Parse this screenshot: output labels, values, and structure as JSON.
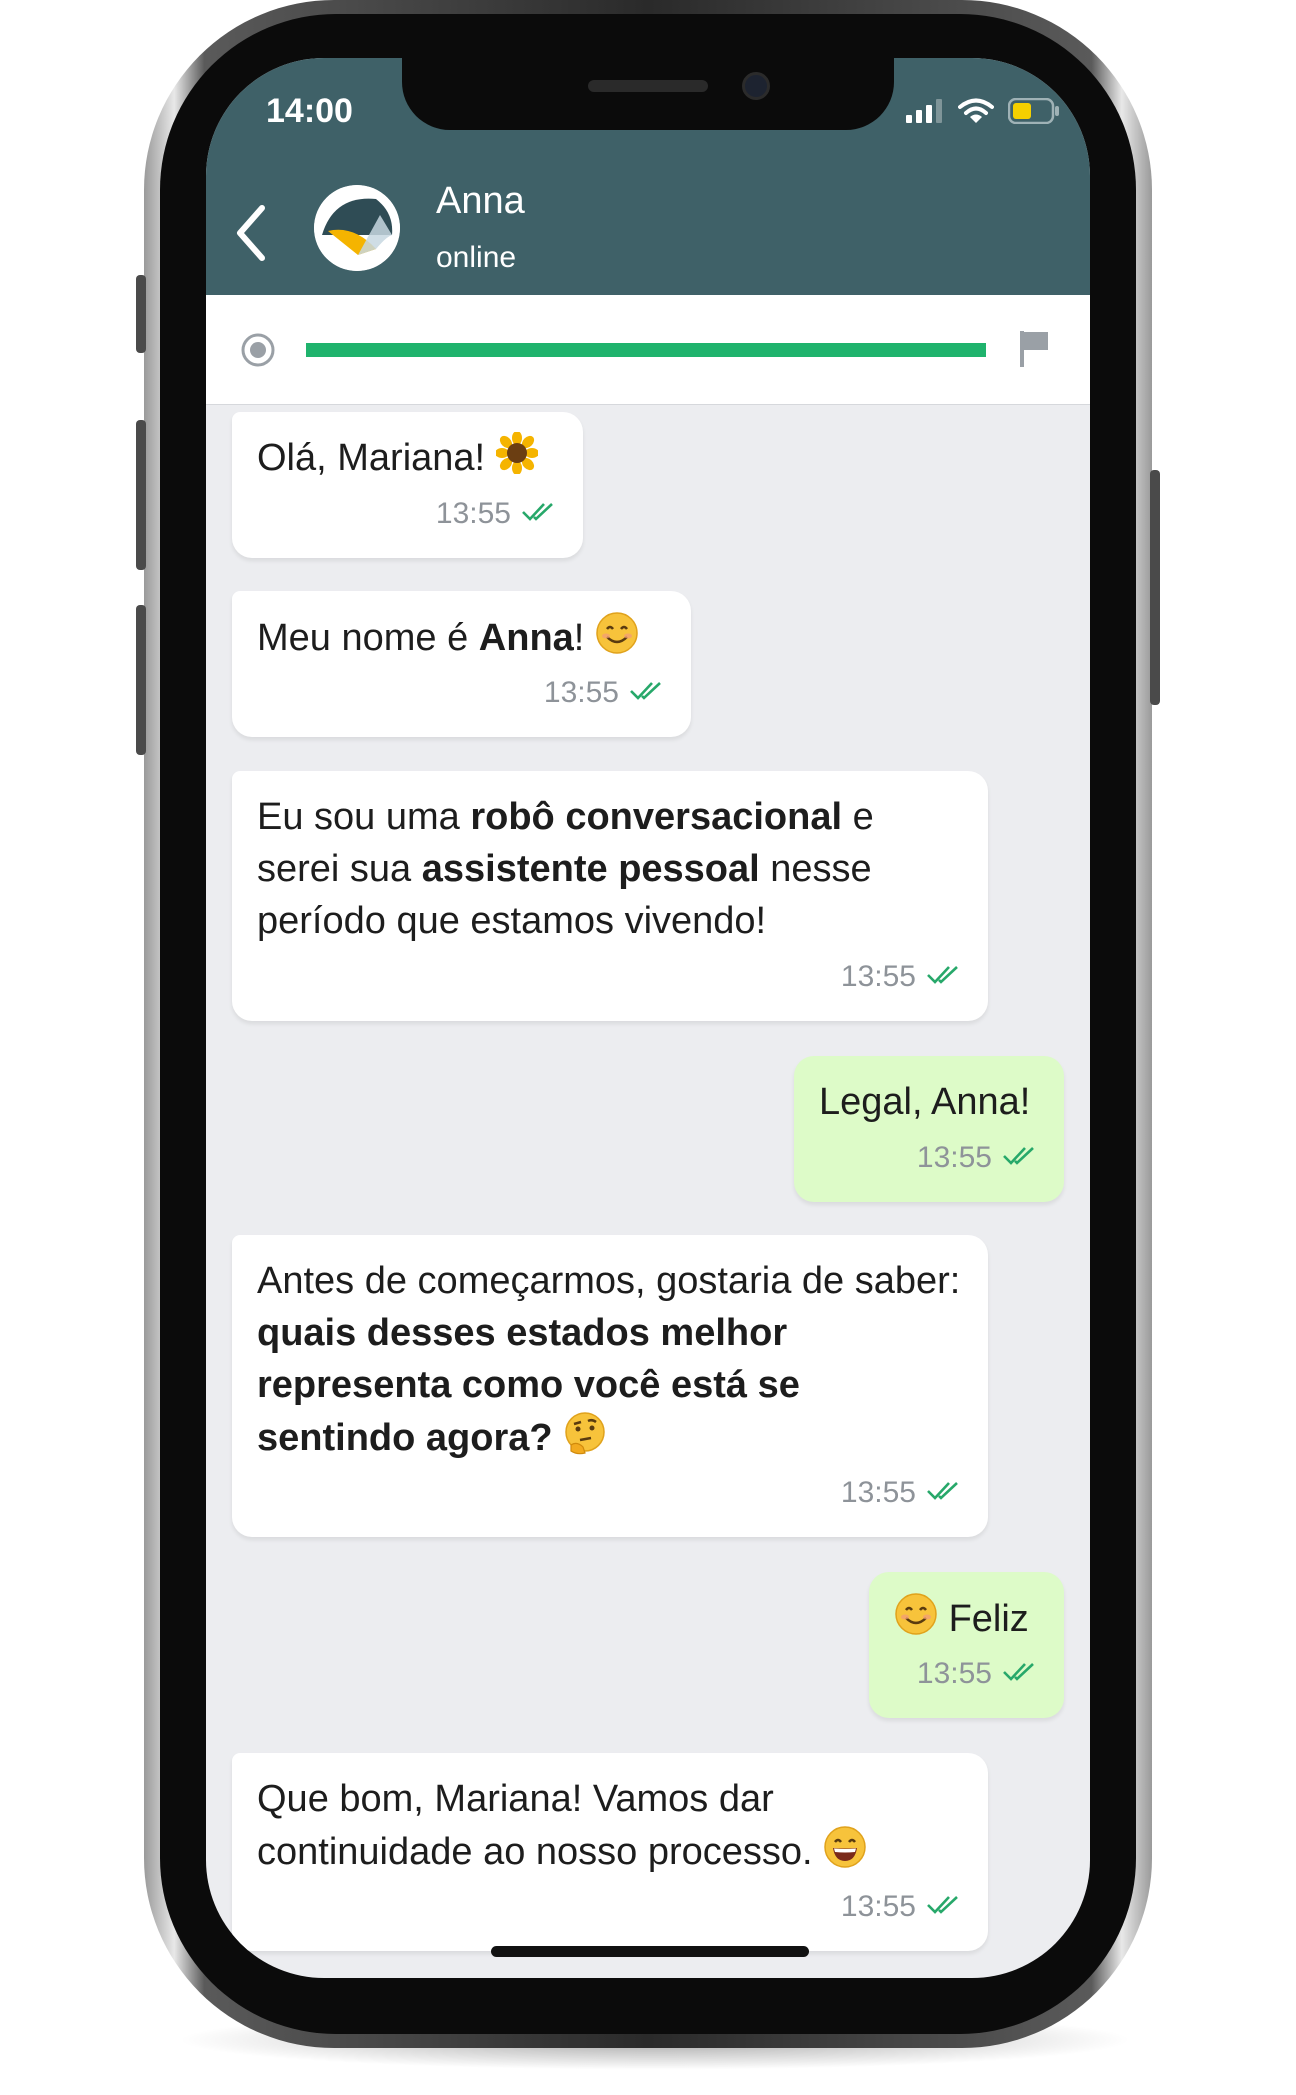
{
  "status_bar": {
    "time": "14:00"
  },
  "header": {
    "contact_name": "Anna",
    "contact_status": "online",
    "back_icon": "chevron-left-icon",
    "avatar_icon": "bot-logo-icon"
  },
  "progress": {
    "value_percent": 100,
    "color": "#1fb36d",
    "start_icon": "radio-dot-icon",
    "end_icon": "flag-icon"
  },
  "messages": [
    {
      "direction": "in",
      "parts": [
        "Olá, Mariana! "
      ],
      "emoji": "sunflower-emoji",
      "time": "13:55"
    },
    {
      "direction": "in",
      "parts": [
        "Meu nome é ",
        "Anna",
        "! "
      ],
      "emoji": "smiling-face-emoji",
      "time": "13:55"
    },
    {
      "direction": "in",
      "parts": [
        "Eu sou uma ",
        "robô conversacional",
        " e serei sua ",
        "assistente pessoal",
        " nesse período que estamos vivendo!"
      ],
      "time": "13:55"
    },
    {
      "direction": "out",
      "parts": [
        "Legal, Anna!"
      ],
      "time": "13:55"
    },
    {
      "direction": "in",
      "parts": [
        "Antes de começarmos, gostaria de saber: ",
        "quais desses estados melhor representa como você está se sentindo agora?"
      ],
      "emoji": "thinking-face-emoji",
      "time": "13:55"
    },
    {
      "direction": "out",
      "parts": [
        "Feliz"
      ],
      "emoji": "smiling-face-emoji",
      "time": "13:55"
    },
    {
      "direction": "in",
      "parts": [
        "Que bom, Mariana! Vamos dar continuidade ao nosso processo. "
      ],
      "emoji": "grinning-face-emoji",
      "time": "13:55"
    }
  ],
  "colors": {
    "header": "#3f6168",
    "incoming_bubble": "#ffffff",
    "outgoing_bubble": "#ddfbc8",
    "read_check": "#27a86a",
    "chat_background": "#ecedf0"
  }
}
